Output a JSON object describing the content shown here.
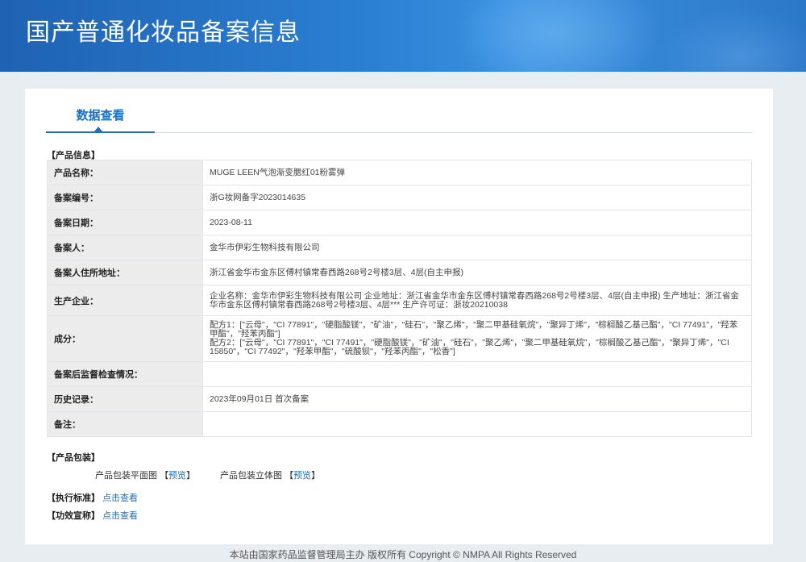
{
  "header": {
    "title": "国产普通化妆品备案信息"
  },
  "tab": {
    "label": "数据查看"
  },
  "product_info": {
    "section_title": "【产品信息】",
    "rows": [
      {
        "label": "产品名称：",
        "value": "MUGE LEEN气泡渐变腮红01粉雾弹"
      },
      {
        "label": "备案编号：",
        "value": "浙G妆网备字2023014635"
      },
      {
        "label": "备案日期：",
        "value": "2023-08-11"
      },
      {
        "label": "备案人：",
        "value": "金华市伊彩生物科技有限公司"
      },
      {
        "label": "备案人住所地址：",
        "value": "浙江省金华市金东区傅村镇常春西路268号2号楼3层、4层(自主申报)"
      },
      {
        "label": "生产企业：",
        "value": "企业名称：金华市伊彩生物科技有限公司 企业地址：浙江省金华市金东区傅村镇常春西路268号2号楼3层、4层(自主申报) 生产地址：浙江省金华市金东区傅村镇常春西路268号2号楼3层、4层*** 生产许可证：浙妆20210038"
      },
      {
        "label": "成分：",
        "value_lines": [
          "配方1：[\"云母\"，\"CI 77891\"，\"硬脂酸镁\"，\"矿油\"，\"硅石\"，\"聚乙烯\"，\"聚二甲基硅氧烷\"，\"聚异丁烯\"，\"棕榈酸乙基己酯\"，\"CI 77491\"，\"羟苯甲酯\"，\"羟苯丙酯\"]",
          "配方2：[\"云母\"，\"CI 77891\"，\"CI 77491\"，\"硬脂酸镁\"，\"矿油\"，\"硅石\"，\"聚乙烯\"，\"聚二甲基硅氧烷\"，\"棕榈酸乙基己酯\"，\"聚异丁烯\"，\"CI 15850\"，\"CI 77492\"，\"羟苯甲酯\"，\"硫酸钡\"，\"羟苯丙酯\"，\"松香\"]"
        ]
      },
      {
        "label": "备案后监督检查情况：",
        "value": ""
      },
      {
        "label": "历史记录：",
        "value": "2023年09月01日 首次备案"
      },
      {
        "label": "备注：",
        "value": ""
      }
    ]
  },
  "packaging": {
    "section_title": "【产品包装】",
    "flat_label": "产品包装平面图",
    "stereo_label": "产品包装立体图",
    "preview_link": "预览",
    "bracket_open": "【",
    "bracket_close": "】"
  },
  "standard": {
    "label": "【执行标准】",
    "link": "点击查看"
  },
  "efficacy": {
    "label": "【功效宣称】",
    "link": "点击查看"
  },
  "footer": {
    "text": "本站由国家药品监督管理局主办 版权所有 Copyright © NMPA All Rights Reserved"
  }
}
